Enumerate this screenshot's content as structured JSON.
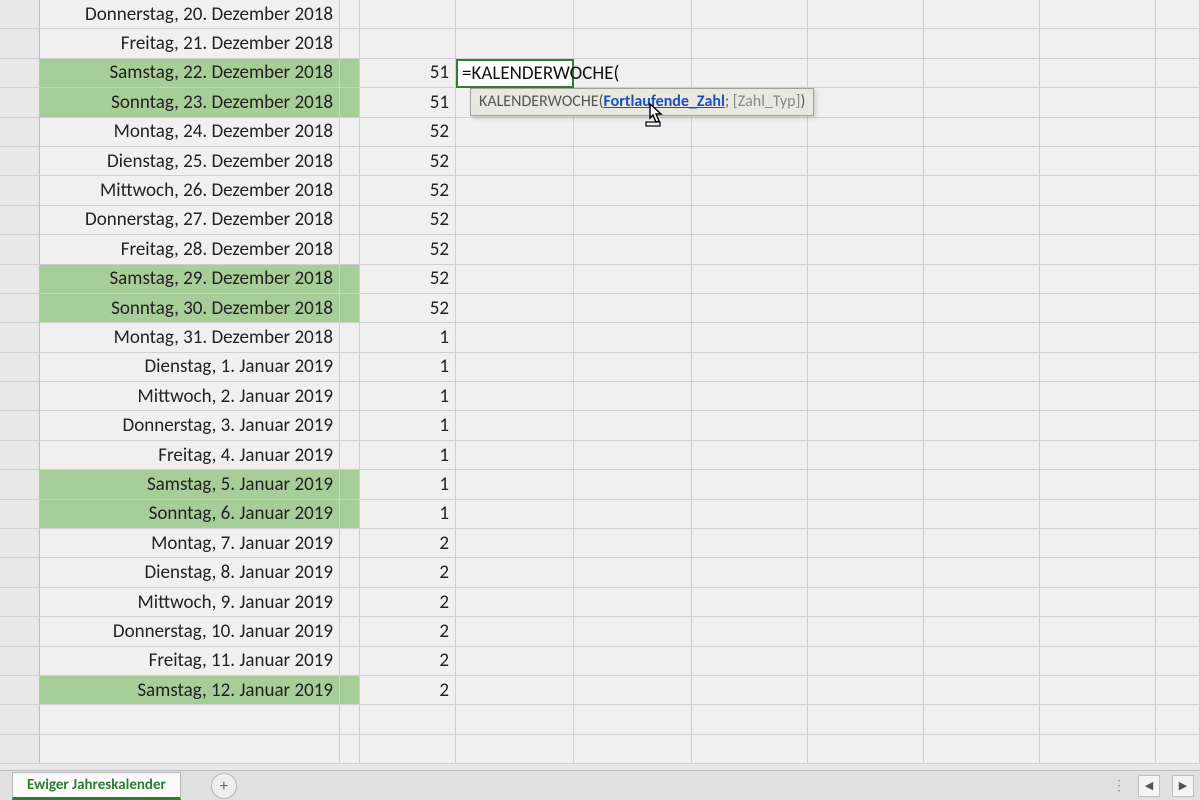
{
  "formula_input": "=KALENDERWOCHE(",
  "tooltip": {
    "fn_name": "KALENDERWOCHE",
    "open": "(",
    "arg_active": "Fortlaufende_Zahl",
    "sep": "; ",
    "arg_optional": "[Zahl_Typ]",
    "close": ")"
  },
  "rows": [
    {
      "date": "Donnerstag, 20. Dezember 2018",
      "week": "",
      "weekend": false,
      "editing": false
    },
    {
      "date": "Freitag, 21. Dezember 2018",
      "week": "",
      "weekend": false,
      "editing": false
    },
    {
      "date": "Samstag, 22. Dezember 2018",
      "week": "51",
      "weekend": true,
      "editing": true
    },
    {
      "date": "Sonntag, 23. Dezember 2018",
      "week": "51",
      "weekend": true,
      "editing": false
    },
    {
      "date": "Montag, 24. Dezember 2018",
      "week": "52",
      "weekend": false,
      "editing": false
    },
    {
      "date": "Dienstag, 25. Dezember 2018",
      "week": "52",
      "weekend": false,
      "editing": false
    },
    {
      "date": "Mittwoch, 26. Dezember 2018",
      "week": "52",
      "weekend": false,
      "editing": false
    },
    {
      "date": "Donnerstag, 27. Dezember 2018",
      "week": "52",
      "weekend": false,
      "editing": false
    },
    {
      "date": "Freitag, 28. Dezember 2018",
      "week": "52",
      "weekend": false,
      "editing": false
    },
    {
      "date": "Samstag, 29. Dezember 2018",
      "week": "52",
      "weekend": true,
      "editing": false
    },
    {
      "date": "Sonntag, 30. Dezember 2018",
      "week": "52",
      "weekend": true,
      "editing": false
    },
    {
      "date": "Montag, 31. Dezember 2018",
      "week": "1",
      "weekend": false,
      "editing": false
    },
    {
      "date": "Dienstag, 1. Januar 2019",
      "week": "1",
      "weekend": false,
      "editing": false
    },
    {
      "date": "Mittwoch, 2. Januar 2019",
      "week": "1",
      "weekend": false,
      "editing": false
    },
    {
      "date": "Donnerstag, 3. Januar 2019",
      "week": "1",
      "weekend": false,
      "editing": false
    },
    {
      "date": "Freitag, 4. Januar 2019",
      "week": "1",
      "weekend": false,
      "editing": false
    },
    {
      "date": "Samstag, 5. Januar 2019",
      "week": "1",
      "weekend": true,
      "editing": false
    },
    {
      "date": "Sonntag, 6. Januar 2019",
      "week": "1",
      "weekend": true,
      "editing": false
    },
    {
      "date": "Montag, 7. Januar 2019",
      "week": "2",
      "weekend": false,
      "editing": false
    },
    {
      "date": "Dienstag, 8. Januar 2019",
      "week": "2",
      "weekend": false,
      "editing": false
    },
    {
      "date": "Mittwoch, 9. Januar 2019",
      "week": "2",
      "weekend": false,
      "editing": false
    },
    {
      "date": "Donnerstag, 10. Januar 2019",
      "week": "2",
      "weekend": false,
      "editing": false
    },
    {
      "date": "Freitag, 11. Januar 2019",
      "week": "2",
      "weekend": false,
      "editing": false
    },
    {
      "date": "Samstag, 12. Januar 2019",
      "week": "2",
      "weekend": true,
      "editing": false
    },
    {
      "date": "",
      "week": "",
      "weekend": false,
      "editing": false
    },
    {
      "date": "",
      "week": "",
      "weekend": false,
      "editing": false
    }
  ],
  "tab_name": "Ewiger Jahreskalender",
  "tab_add_glyph": "+",
  "tabbar_dots": "⋮",
  "scroll_left_glyph": "◀",
  "scroll_right_glyph": "▶"
}
